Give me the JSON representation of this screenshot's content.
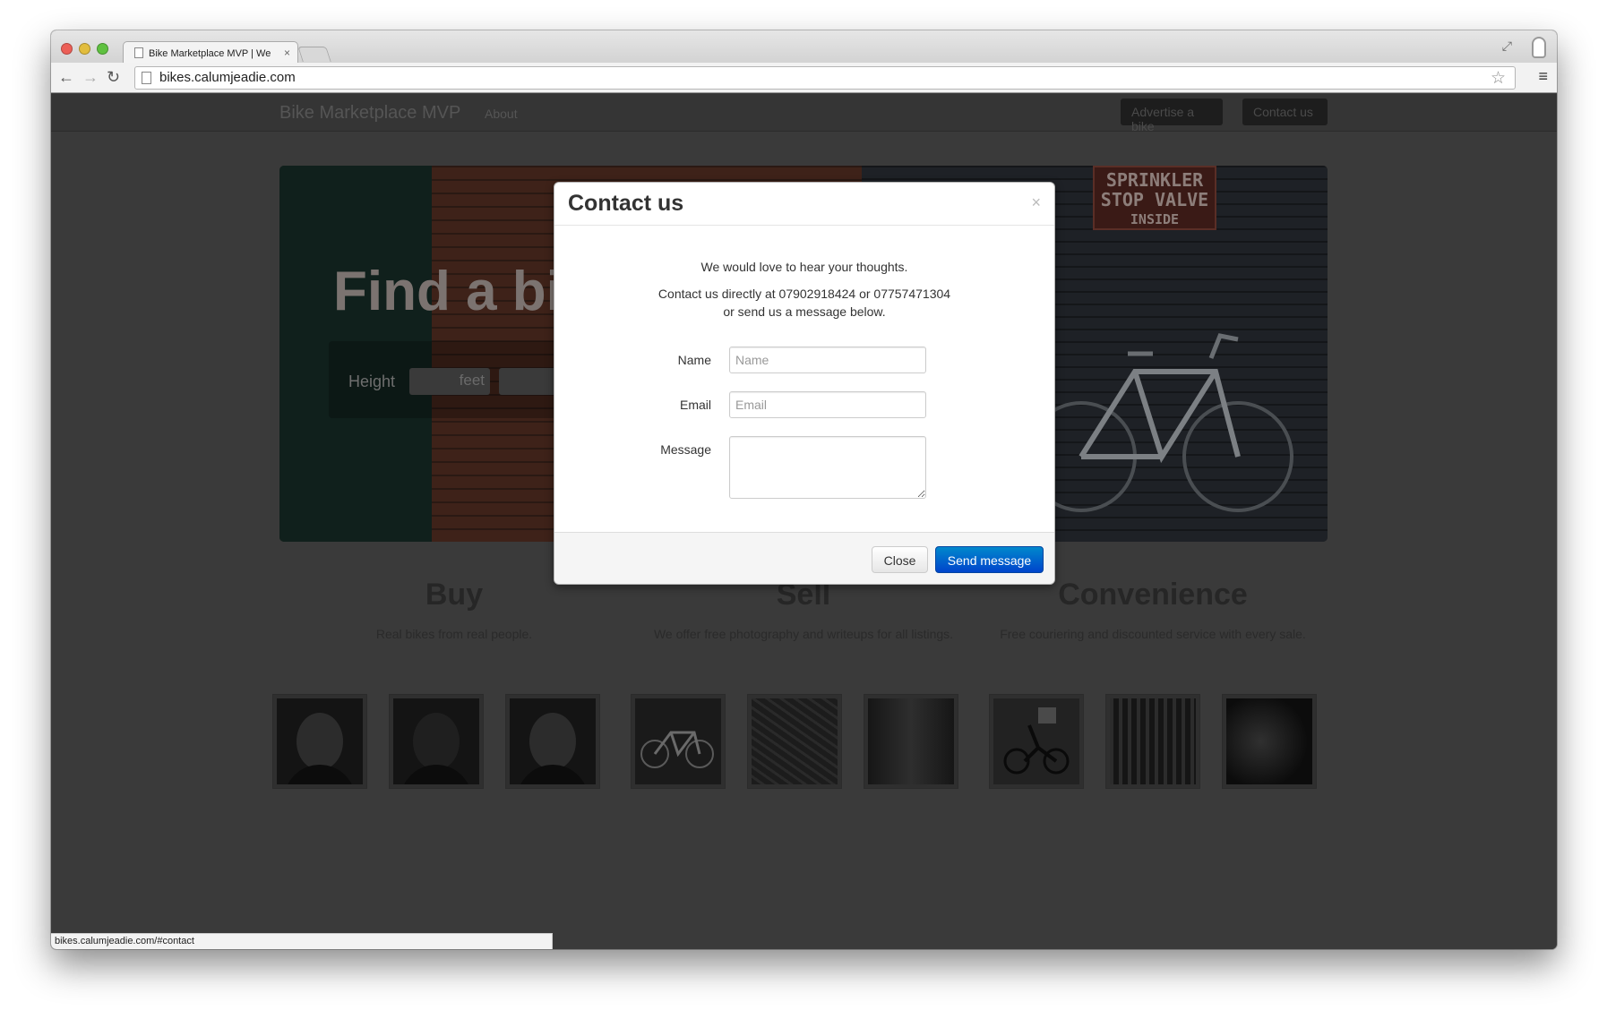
{
  "browser": {
    "tab_title": "Bike Marketplace MVP | We",
    "url": "bikes.calumjeadie.com",
    "status_url": "bikes.calumjeadie.com/#contact"
  },
  "navbar": {
    "brand": "Bike Marketplace MVP",
    "about": "About",
    "advertise": "Advertise a bike",
    "contact": "Contact us"
  },
  "hero": {
    "title": "Find a bi",
    "height_label": "Height",
    "feet_placeholder": "feet",
    "sign_line1": "SPRINKLER",
    "sign_line2": "STOP VALVE",
    "sign_line3": "INSIDE"
  },
  "features": [
    {
      "title": "Buy",
      "text": "Real bikes from real people."
    },
    {
      "title": "Sell",
      "text": "We offer free photography and writeups for all listings."
    },
    {
      "title": "Convenience",
      "text": "Free couriering and discounted service with every sale."
    }
  ],
  "modal": {
    "title": "Contact us",
    "close_x": "×",
    "intro": "We would love to hear your thoughts.",
    "contact_line1": "Contact us directly at 07902918424 or 07757471304",
    "contact_line2": "or send us a message below.",
    "name_label": "Name",
    "name_placeholder": "Name",
    "email_label": "Email",
    "email_placeholder": "Email",
    "message_label": "Message",
    "close_button": "Close",
    "send_button": "Send message"
  },
  "icons": {
    "back": "←",
    "forward": "→",
    "reload": "↻",
    "star": "☆",
    "menu": "≡",
    "fullscreen": "⤢",
    "tab_close": "×"
  },
  "colors": {
    "primary_button": "#0066cc",
    "overlay": "#3a3a3a"
  }
}
